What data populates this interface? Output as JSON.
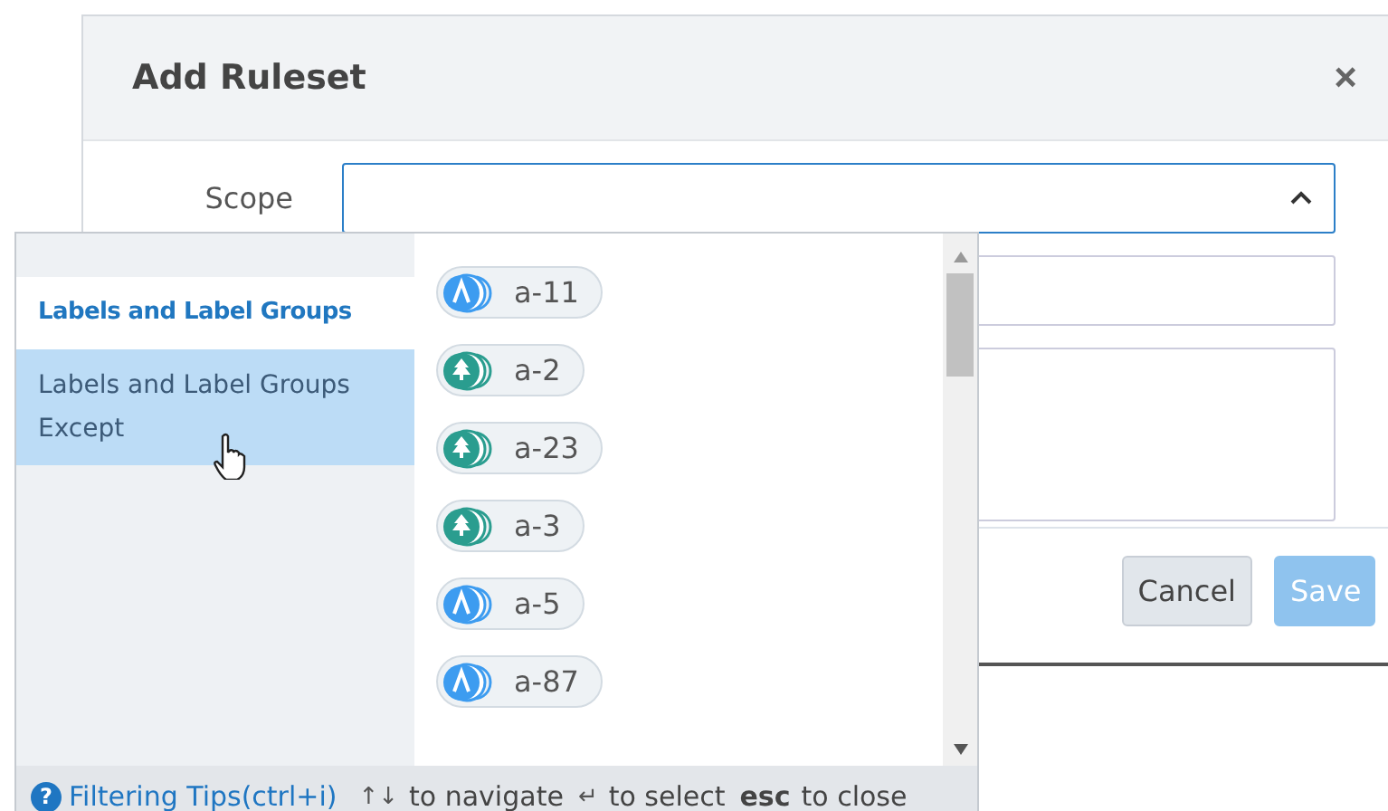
{
  "dialog": {
    "title": "Add Ruleset",
    "close": "×",
    "scope": {
      "label": "Scope",
      "expanded": true
    },
    "buttons": [
      {
        "label": "Cancel",
        "kind": "secondary",
        "disabled": false
      },
      {
        "label": "Save",
        "kind": "primary",
        "disabled": true
      }
    ]
  },
  "dropdown": {
    "categories": [
      {
        "label": "Labels and Label Groups",
        "selected": true,
        "hovered": false
      },
      {
        "label": "Labels and Label Groups Except",
        "selected": false,
        "hovered": true
      }
    ],
    "options": [
      {
        "label": "a-11",
        "kind": "app"
      },
      {
        "label": "a-2",
        "kind": "env"
      },
      {
        "label": "a-23",
        "kind": "env"
      },
      {
        "label": "a-3",
        "kind": "env"
      },
      {
        "label": "a-5",
        "kind": "app"
      },
      {
        "label": "a-87",
        "kind": "app"
      }
    ],
    "footer": {
      "help": "?",
      "tips": "Filtering Tips(ctrl+i)",
      "hints": [
        {
          "key": "↑↓",
          "text": "to navigate",
          "bold": false
        },
        {
          "key": "↵",
          "text": "to select",
          "bold": false
        },
        {
          "key": "esc",
          "text": "to close",
          "bold": true
        }
      ]
    }
  }
}
